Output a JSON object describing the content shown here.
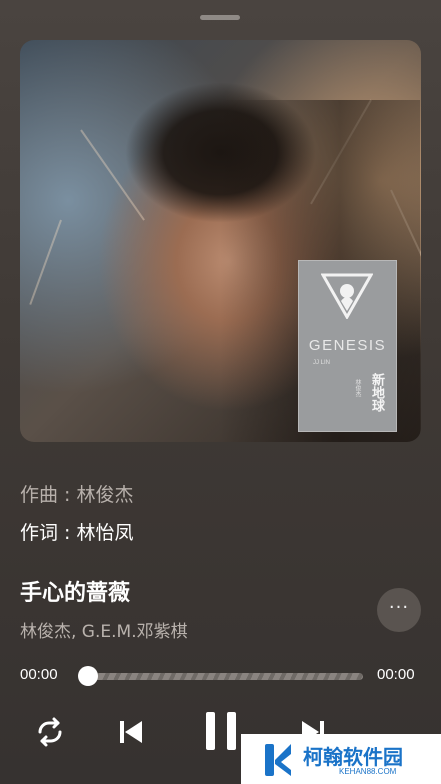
{
  "album": {
    "card_title_en": "GENESIS",
    "card_artist_en": "JJ LIN",
    "card_artist_cn": "林俊杰",
    "card_title_cn": "新地球"
  },
  "credits": {
    "composer": "作曲 : 林俊杰",
    "lyricist": "作词 : 林怡凤"
  },
  "song": {
    "title": "手心的蔷薇",
    "artist": "林俊杰, G.E.M.邓紫棋"
  },
  "more_label": "···",
  "player": {
    "current_time": "00:00",
    "total_time": "00:00",
    "progress_fraction": 0.0
  },
  "icons": {
    "repeat": "repeat-icon",
    "prev": "skip-previous-icon",
    "pause": "pause-icon",
    "next": "skip-next-icon"
  },
  "watermark": {
    "name_cn": "柯翰软件园",
    "domain": "KEHAN88.COM"
  },
  "colors": {
    "background": "#3f3935",
    "accent": "#ffffff",
    "secondary_text": "#b7b0ab",
    "watermark_blue": "#1a73c8"
  }
}
